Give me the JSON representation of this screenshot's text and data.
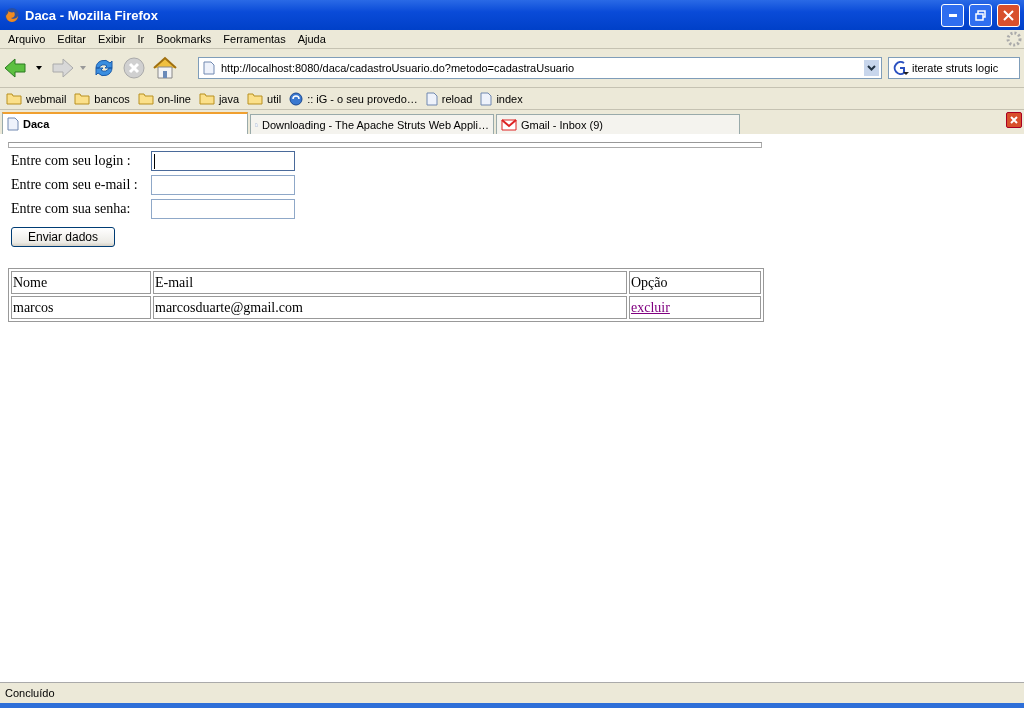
{
  "window": {
    "title": "Daca - Mozilla Firefox"
  },
  "menu": [
    "Arquivo",
    "Editar",
    "Exibir",
    "Ir",
    "Bookmarks",
    "Ferramentas",
    "Ajuda"
  ],
  "address": {
    "value": "http://localhost:8080/daca/cadastroUsuario.do?metodo=cadastraUsuario"
  },
  "search": {
    "value": "iterate struts logic"
  },
  "bookmarks": [
    {
      "label": "webmail",
      "kind": "folder"
    },
    {
      "label": "bancos",
      "kind": "folder"
    },
    {
      "label": "on-line",
      "kind": "folder"
    },
    {
      "label": "java",
      "kind": "folder"
    },
    {
      "label": "util",
      "kind": "folder"
    },
    {
      "label": ":: iG - o seu provedo…",
      "kind": "site"
    },
    {
      "label": "reload",
      "kind": "page"
    },
    {
      "label": "index",
      "kind": "page"
    }
  ],
  "tabs": [
    {
      "label": "Daca",
      "selected": true,
      "kind": "page"
    },
    {
      "label": "Downloading - The Apache Struts Web Appli…",
      "selected": false,
      "kind": "page"
    },
    {
      "label": "Gmail - Inbox (9)",
      "selected": false,
      "kind": "gmail"
    }
  ],
  "form": {
    "fields": [
      {
        "label": "Entre com seu login :",
        "focused": true
      },
      {
        "label": "Entre com seu e-mail :",
        "focused": false
      },
      {
        "label": "Entre com sua senha:",
        "focused": false
      }
    ],
    "submit": "Enviar dados"
  },
  "table": {
    "columns": [
      "Nome",
      "E-mail",
      "Opção"
    ],
    "rows": [
      {
        "cells": [
          "marcos",
          "marcosduarte@gmail.com"
        ],
        "action": "excluir"
      }
    ]
  },
  "status_bar": "Concluído"
}
